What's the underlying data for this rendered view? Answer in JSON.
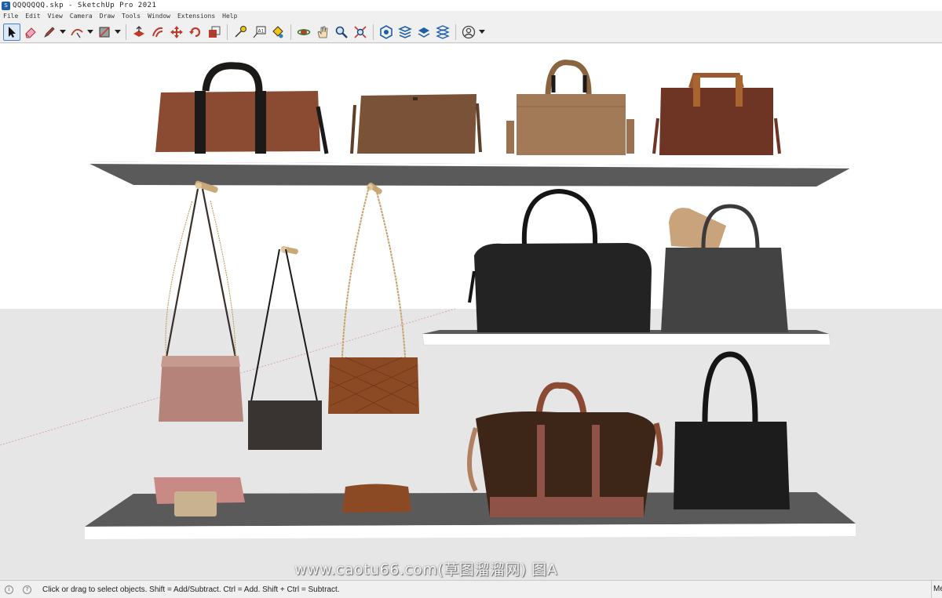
{
  "window": {
    "title": "QQQQQQQ.skp - SketchUp Pro 2021"
  },
  "menu": {
    "items": [
      "File",
      "Edit",
      "View",
      "Camera",
      "Draw",
      "Tools",
      "Window",
      "Extensions",
      "Help"
    ]
  },
  "toolbar": {
    "tools": [
      {
        "name": "select",
        "icon": "arrow-cursor-icon",
        "active": true
      },
      {
        "name": "eraser",
        "icon": "eraser-icon"
      },
      {
        "name": "line",
        "icon": "pencil-icon",
        "dropdown": true
      },
      {
        "name": "arc",
        "icon": "arc-icon",
        "dropdown": true
      },
      {
        "name": "rectangle",
        "icon": "rectangle-icon",
        "dropdown": true
      },
      {
        "name": "push-pull",
        "icon": "push-pull-icon"
      },
      {
        "name": "offset",
        "icon": "offset-icon"
      },
      {
        "name": "move",
        "icon": "move-icon"
      },
      {
        "name": "rotate",
        "icon": "rotate-icon"
      },
      {
        "name": "scale",
        "icon": "scale-icon"
      },
      {
        "name": "tape-measure",
        "icon": "tape-measure-icon"
      },
      {
        "name": "text",
        "icon": "text-icon"
      },
      {
        "name": "paint-bucket",
        "icon": "paint-bucket-icon"
      },
      {
        "name": "orbit",
        "icon": "orbit-icon"
      },
      {
        "name": "pan",
        "icon": "pan-hand-icon"
      },
      {
        "name": "zoom",
        "icon": "zoom-icon"
      },
      {
        "name": "zoom-extents",
        "icon": "zoom-extents-icon"
      },
      {
        "name": "3d-warehouse",
        "icon": "warehouse-icon"
      },
      {
        "name": "extension-warehouse",
        "icon": "extension-warehouse-icon"
      },
      {
        "name": "layout",
        "icon": "layout-icon"
      },
      {
        "name": "extension-manager",
        "icon": "extension-manager-icon"
      },
      {
        "name": "account",
        "icon": "account-icon",
        "dropdown": true
      }
    ]
  },
  "viewport": {
    "sky_color": "#ffffff",
    "ground_color": "#e6e6e6",
    "shelf_color": "#5a5a5a",
    "watermark": "www.caotu66.com(草图溜溜网) 图A"
  },
  "status": {
    "hint": "Click or drag to select objects. Shift = Add/Subtract. Ctrl = Add. Shift + Ctrl = Subtract.",
    "measurements_label": "Me"
  }
}
